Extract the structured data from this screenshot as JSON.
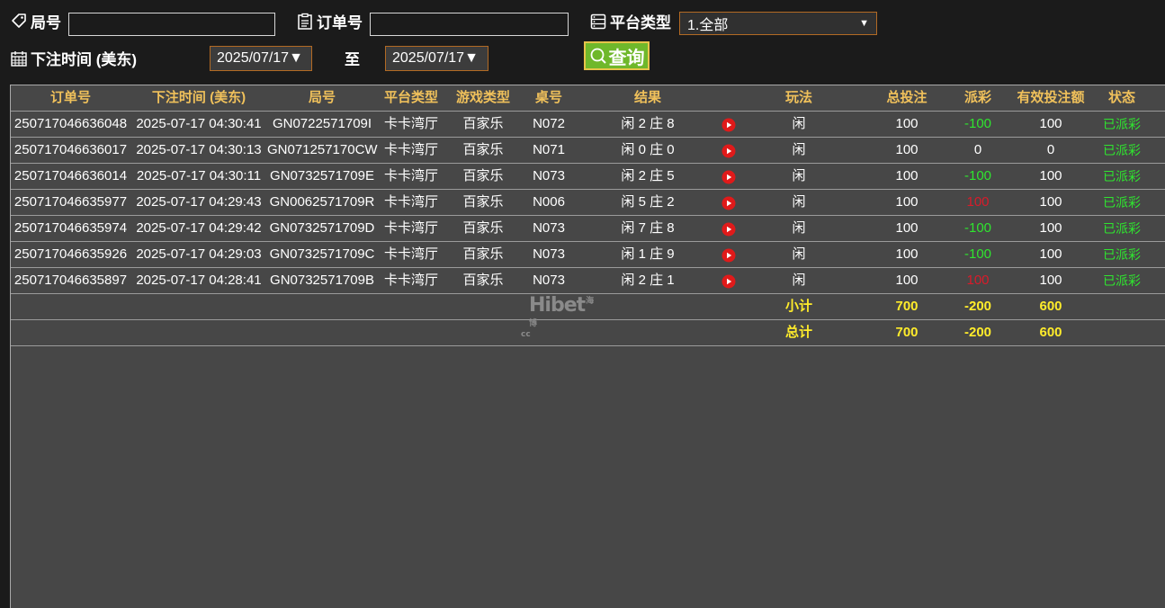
{
  "filters": {
    "round_label": "局号",
    "round_value": "",
    "order_label": "订单号",
    "order_value": "",
    "platform_label": "平台类型",
    "platform_selected": "1.全部",
    "time_label": "下注时间 (美东)",
    "date_from": "2025/07/17▼",
    "to_label": "至",
    "date_to": "2025/07/17▼",
    "query_label": "查询"
  },
  "table": {
    "headers": [
      "订单号",
      "下注时间 (美东)",
      "局号",
      "平台类型",
      "游戏类型",
      "桌号",
      "结果",
      "",
      "玩法",
      "总投注",
      "派彩",
      "有效投注额",
      "状态"
    ],
    "rows": [
      {
        "order": "250717046636048",
        "time": "2025-07-17 04:30:41",
        "round": "GN0722571709I",
        "platform": "卡卡湾厅",
        "game": "百家乐",
        "table": "N072",
        "result": "闲 2 庄 8",
        "play": "闲",
        "bet": "100",
        "payout": "-100",
        "payout_color": "green",
        "valid": "100",
        "status": "已派彩"
      },
      {
        "order": "250717046636017",
        "time": "2025-07-17 04:30:13",
        "round": "GN071257170CW",
        "platform": "卡卡湾厅",
        "game": "百家乐",
        "table": "N071",
        "result": "闲 0 庄 0",
        "play": "闲",
        "bet": "100",
        "payout": "0",
        "payout_color": "white",
        "valid": "0",
        "status": "已派彩"
      },
      {
        "order": "250717046636014",
        "time": "2025-07-17 04:30:11",
        "round": "GN0732571709E",
        "platform": "卡卡湾厅",
        "game": "百家乐",
        "table": "N073",
        "result": "闲 2 庄 5",
        "play": "闲",
        "bet": "100",
        "payout": "-100",
        "payout_color": "green",
        "valid": "100",
        "status": "已派彩"
      },
      {
        "order": "250717046635977",
        "time": "2025-07-17 04:29:43",
        "round": "GN0062571709R",
        "platform": "卡卡湾厅",
        "game": "百家乐",
        "table": "N006",
        "result": "闲 5 庄 2",
        "play": "闲",
        "bet": "100",
        "payout": "100",
        "payout_color": "red",
        "valid": "100",
        "status": "已派彩"
      },
      {
        "order": "250717046635974",
        "time": "2025-07-17 04:29:42",
        "round": "GN0732571709D",
        "platform": "卡卡湾厅",
        "game": "百家乐",
        "table": "N073",
        "result": "闲 7 庄 8",
        "play": "闲",
        "bet": "100",
        "payout": "-100",
        "payout_color": "green",
        "valid": "100",
        "status": "已派彩"
      },
      {
        "order": "250717046635926",
        "time": "2025-07-17 04:29:03",
        "round": "GN0732571709C",
        "platform": "卡卡湾厅",
        "game": "百家乐",
        "table": "N073",
        "result": "闲 1 庄 9",
        "play": "闲",
        "bet": "100",
        "payout": "-100",
        "payout_color": "green",
        "valid": "100",
        "status": "已派彩"
      },
      {
        "order": "250717046635897",
        "time": "2025-07-17 04:28:41",
        "round": "GN0732571709B",
        "platform": "卡卡湾厅",
        "game": "百家乐",
        "table": "N073",
        "result": "闲 2 庄 1",
        "play": "闲",
        "bet": "100",
        "payout": "100",
        "payout_color": "red",
        "valid": "100",
        "status": "已派彩"
      }
    ],
    "subtotal": {
      "label": "小计",
      "bet": "700",
      "payout": "-200",
      "valid": "600"
    },
    "total": {
      "label": "总计",
      "bet": "700",
      "payout": "-200",
      "valid": "600"
    }
  },
  "watermark": {
    "text": "Hibet",
    "suffix": "cc",
    "cn": "海博"
  },
  "colors": {
    "accent": "#f0c15b",
    "positive": "#2fe52f",
    "negative": "#d91b2a",
    "total": "#ffec2b",
    "button": "#6fb82b"
  }
}
